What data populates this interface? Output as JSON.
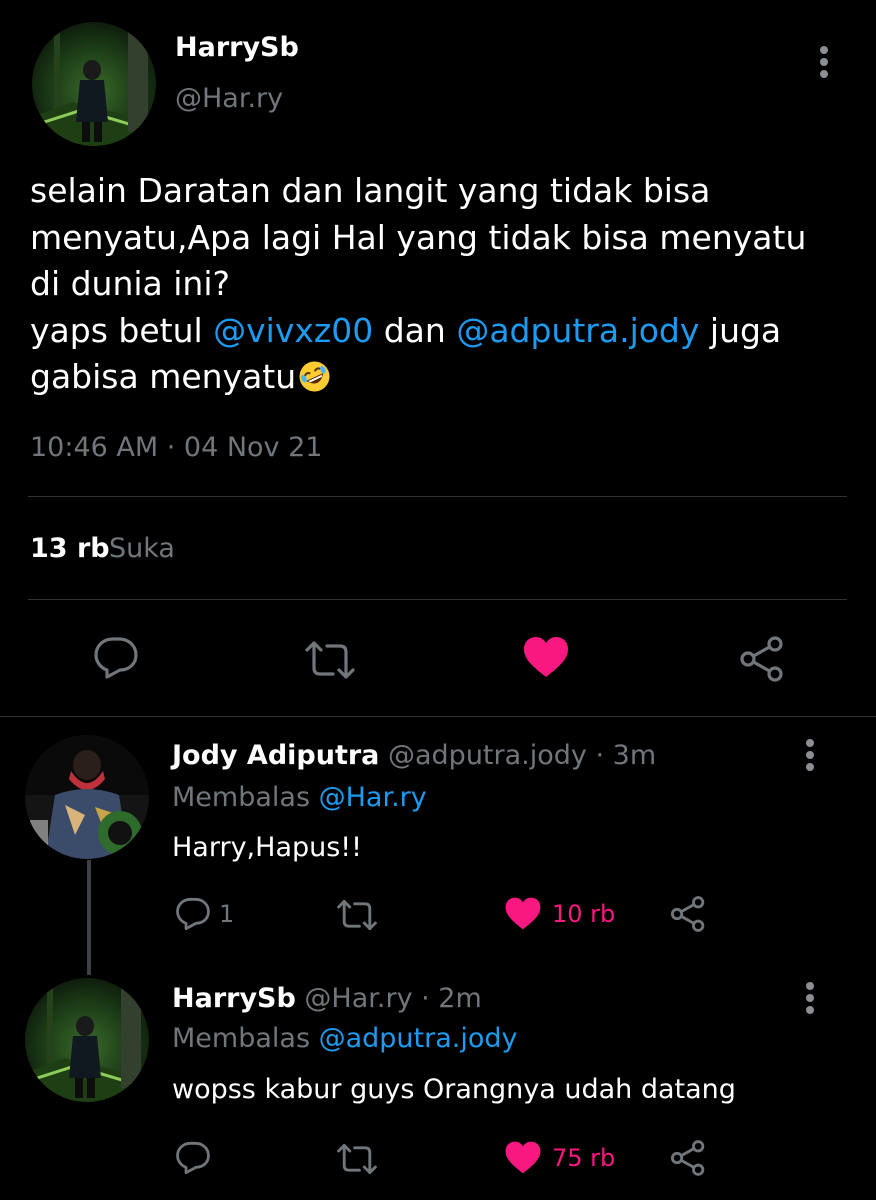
{
  "main_tweet": {
    "author_name": "HarrySb",
    "author_handle": "@Har.ry",
    "text_line1": "selain Daratan dan langit yang tidak bisa",
    "text_line2": "menyatu,Apa lagi Hal yang tidak bisa menyatu",
    "text_line3": "di dunia ini?",
    "text_line4_prefix": "yaps betul ",
    "mention1": "@vivxz00",
    "text_line4_mid": " dan ",
    "mention2": "@adputra.jody",
    "text_line4_suffix": " juga",
    "text_line5": "gabisa menyatu",
    "timestamp": "10:46 AM · 04 Nov 21",
    "likes_count": "13 rb",
    "likes_label": "Suka"
  },
  "replies": [
    {
      "author_name": "Jody Adiputra",
      "meta": "@adputra.jody · 3m",
      "reply_prefix": "Membalas ",
      "reply_to": "@Har.ry",
      "text": "Harry,Hapus!!",
      "reply_count": "1",
      "like_count": "10 rb"
    },
    {
      "author_name": "HarrySb",
      "meta": "@Har.ry · 2m",
      "reply_prefix": "Membalas ",
      "reply_to": "@adputra.jody",
      "text": "wopss kabur guys Orangnya udah datang",
      "reply_count": "",
      "like_count": "75 rb"
    }
  ],
  "icons": {
    "reply": "reply-icon",
    "retweet": "retweet-icon",
    "like": "heart-icon",
    "share": "share-icon",
    "more": "more-options-icon",
    "emoji": "rolling-laughing-emoji"
  },
  "colors": {
    "background": "#000000",
    "text": "#ffffff",
    "muted": "#71767b",
    "link": "#1d9bf0",
    "like": "#f91880"
  }
}
